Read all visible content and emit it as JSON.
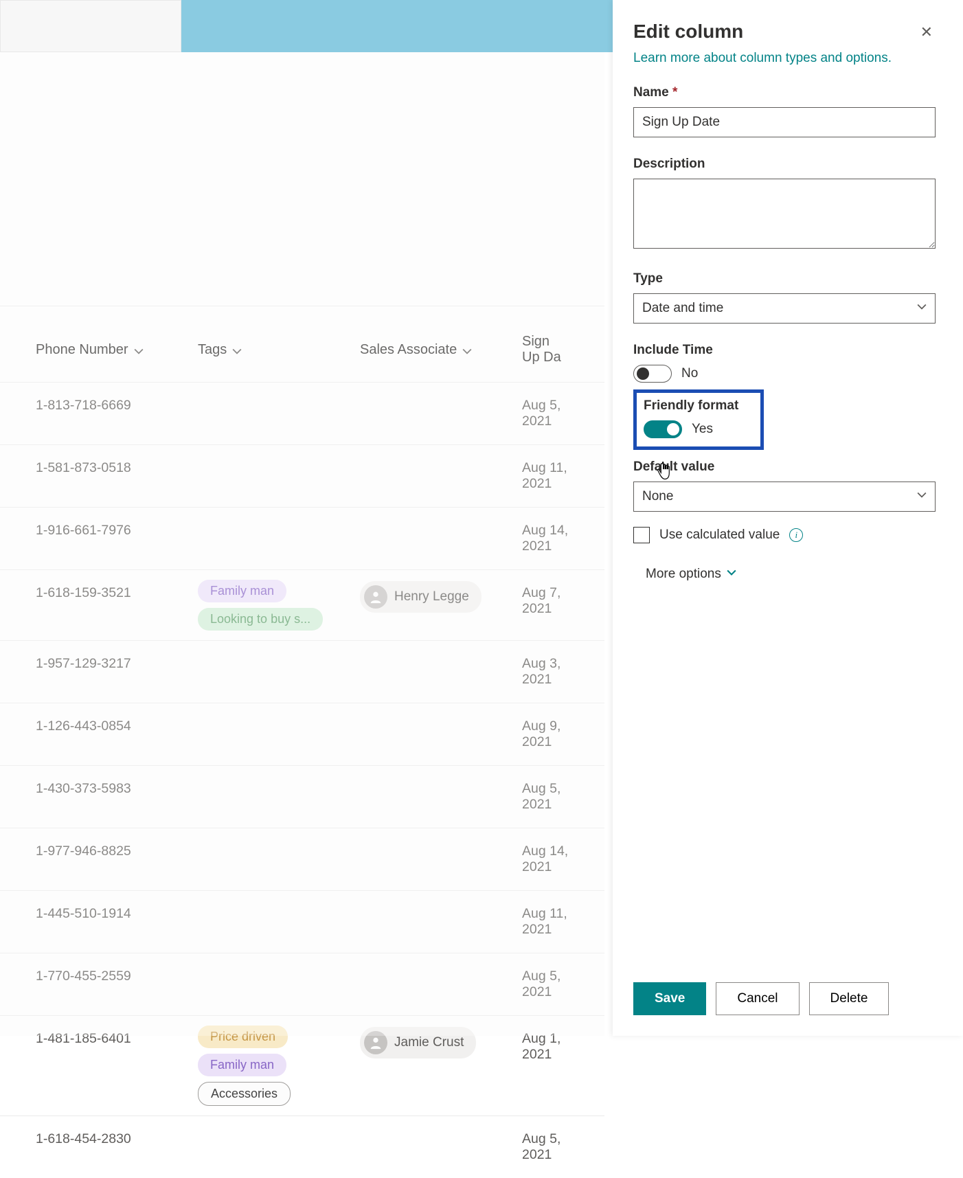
{
  "columns": {
    "phone": "Phone Number",
    "tags": "Tags",
    "sales_assoc": "Sales Associate",
    "signup": "Sign Up Da"
  },
  "rows": [
    {
      "phone": "1-813-718-6669",
      "tags": [],
      "assoc": null,
      "date": "Aug 5, 2021"
    },
    {
      "phone": "1-581-873-0518",
      "tags": [],
      "assoc": null,
      "date": "Aug 11, 2021"
    },
    {
      "phone": "1-916-661-7976",
      "tags": [],
      "assoc": null,
      "date": "Aug 14, 2021"
    },
    {
      "phone": "1-618-159-3521",
      "tags": [
        {
          "t": "Family man",
          "c": "purple"
        },
        {
          "t": "Looking to buy s...",
          "c": "green"
        }
      ],
      "assoc": "Henry Legge",
      "date": "Aug 7, 2021"
    },
    {
      "phone": "1-957-129-3217",
      "tags": [],
      "assoc": null,
      "date": "Aug 3, 2021"
    },
    {
      "phone": "1-126-443-0854",
      "tags": [],
      "assoc": null,
      "date": "Aug 9, 2021"
    },
    {
      "phone": "1-430-373-5983",
      "tags": [],
      "assoc": null,
      "date": "Aug 5, 2021"
    },
    {
      "phone": "1-977-946-8825",
      "tags": [],
      "assoc": null,
      "date": "Aug 14, 2021"
    },
    {
      "phone": "1-445-510-1914",
      "tags": [],
      "assoc": null,
      "date": "Aug 11, 2021"
    },
    {
      "phone": "1-770-455-2559",
      "tags": [],
      "assoc": null,
      "date": "Aug 5, 2021"
    },
    {
      "phone": "1-481-185-6401",
      "tags": [
        {
          "t": "Price driven",
          "c": "yellow"
        },
        {
          "t": "Family man",
          "c": "purple"
        },
        {
          "t": "Accessories",
          "c": "outline"
        }
      ],
      "assoc": "Jamie Crust",
      "date": "Aug 1, 2021"
    },
    {
      "phone": "1-618-454-2830",
      "tags": [],
      "assoc": null,
      "date": "Aug 5, 2021"
    }
  ],
  "panel": {
    "title": "Edit column",
    "learn_link": "Learn more about column types and options.",
    "name_label": "Name",
    "name_value": "Sign Up Date",
    "desc_label": "Description",
    "desc_value": "",
    "type_label": "Type",
    "type_value": "Date and time",
    "include_time_label": "Include Time",
    "include_time_value": "No",
    "friendly_label": "Friendly format",
    "friendly_value": "Yes",
    "default_label": "Default value",
    "default_value": "None",
    "use_calc_label": "Use calculated value",
    "more_options": "More options",
    "save": "Save",
    "cancel": "Cancel",
    "delete": "Delete"
  }
}
